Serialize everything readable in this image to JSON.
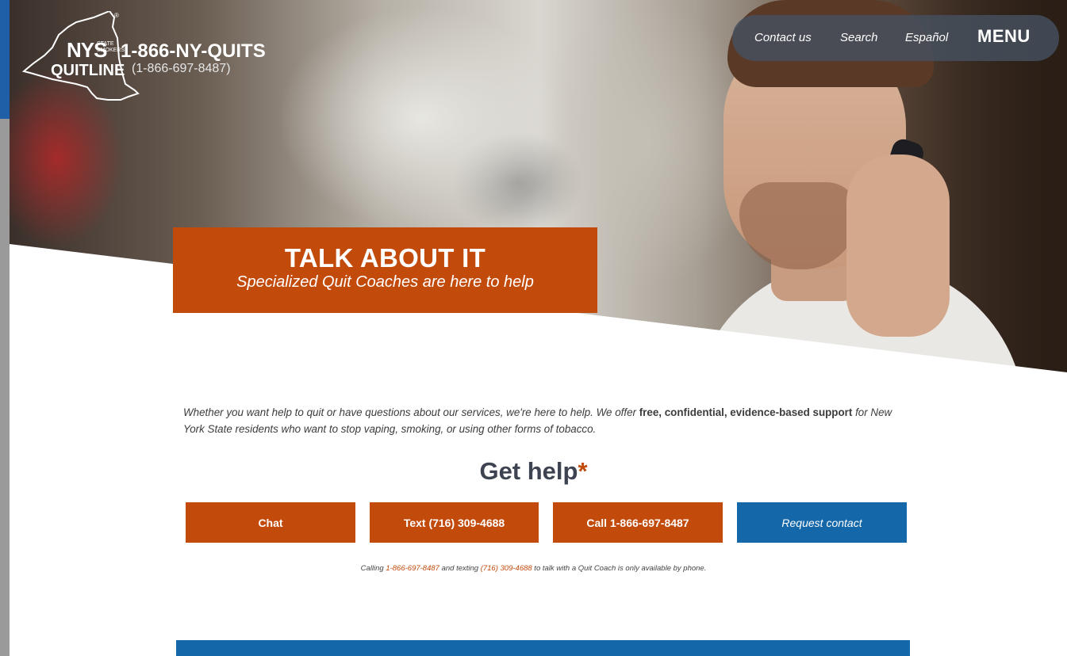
{
  "logo": {
    "nys": "NYS",
    "state_smokers": "STATE\nSMOKERS'",
    "quitline": "QUITLINE",
    "phone_vanity": "1-866-NY-QUITS",
    "phone_numeric": "(1-866-697-8487)"
  },
  "nav": {
    "contact": "Contact us",
    "search": "Search",
    "espanol": "Español",
    "menu": "MENU"
  },
  "banner": {
    "title": "TALK ABOUT IT",
    "subtitle": "Specialized Quit Coaches are here to help"
  },
  "intro": {
    "part1": "Whether you want help to quit or have questions about our services, we're here to help. We offer ",
    "bold": "free, confidential, evidence-based support",
    "part2": " for New York State residents who want to stop vaping, smoking, or using other forms of tobacco."
  },
  "get_help": {
    "title": "Get help",
    "asterisk": "*"
  },
  "buttons": {
    "chat": "Chat",
    "text": "Text (716) 309-4688",
    "call": "Call 1-866-697-8487",
    "request": "Request contact"
  },
  "note": {
    "a": "Calling ",
    "phone": "1-866-697-8487",
    "b": " and texting ",
    "text_number": "(716) 309-4688",
    "c": " to talk with a Quit Coach is only available by phone."
  },
  "colors": {
    "orange": "#c24a0b",
    "blue": "#1467a8",
    "nav_bg": "#46505f"
  }
}
